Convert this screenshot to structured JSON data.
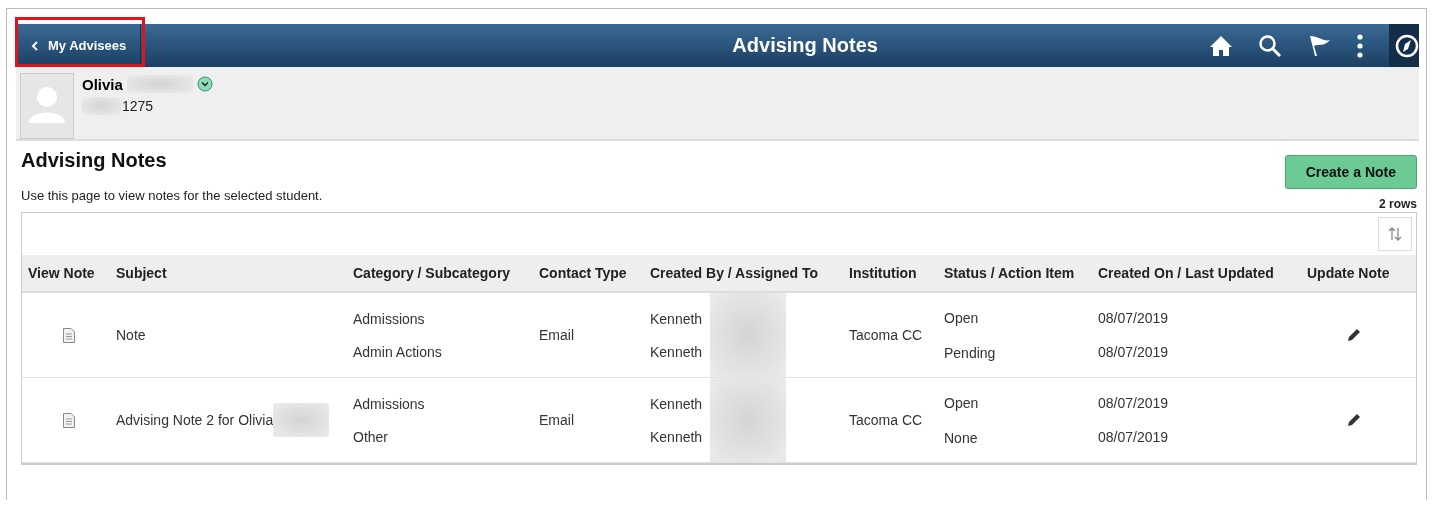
{
  "header": {
    "back_label": "My Advisees",
    "title": "Advising Notes"
  },
  "student": {
    "first_name": "Olivia",
    "id_suffix": "1275"
  },
  "page": {
    "heading": "Advising Notes",
    "description": "Use this page to view notes for the selected student.",
    "create_button": "Create a Note",
    "row_count": "2 rows"
  },
  "table": {
    "columns": [
      "View Note",
      "Subject",
      "Category / Subcategory",
      "Contact Type",
      "Created By / Assigned To",
      "Institution",
      "Status / Action Item",
      "Created On / Last Updated",
      "Update Note"
    ],
    "rows": [
      {
        "subject": "Note",
        "category": "Admissions",
        "subcategory": "Admin Actions",
        "contact_type": "Email",
        "created_by": "Kenneth",
        "assigned_to": "Kenneth",
        "institution": "Tacoma CC",
        "status": "Open",
        "action_item": "Pending",
        "created_on": "08/07/2019",
        "last_updated": "08/07/2019"
      },
      {
        "subject": "Advising Note 2 for Olivia",
        "category": "Admissions",
        "subcategory": "Other",
        "contact_type": "Email",
        "created_by": "Kenneth",
        "assigned_to": "Kenneth",
        "institution": "Tacoma CC",
        "status": "Open",
        "action_item": "None",
        "created_on": "08/07/2019",
        "last_updated": "08/07/2019"
      }
    ]
  }
}
